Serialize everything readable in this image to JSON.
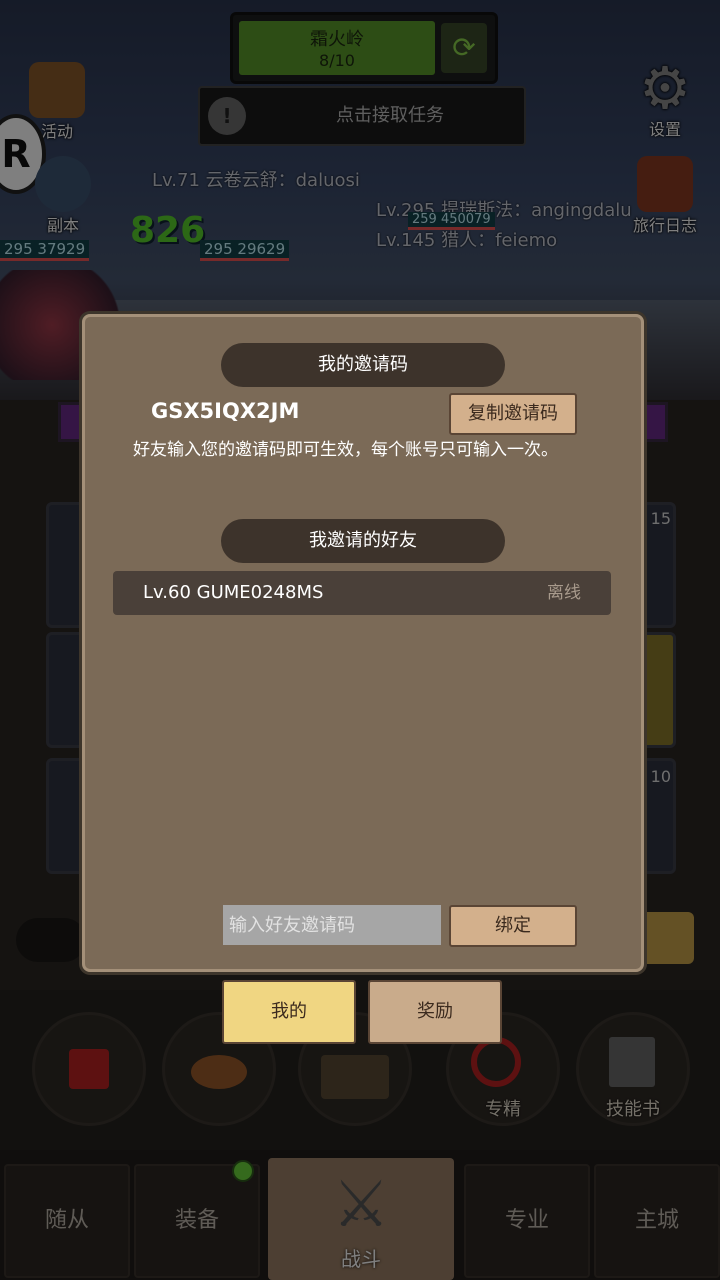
{
  "hud": {
    "stage_title": "霜火岭",
    "stage_progress": "8/10",
    "task_text": "点击接取任务",
    "activity_label": "活动",
    "dungeon_label": "副本",
    "settings_label": "设置",
    "travel_log_label": "旅行日志",
    "gold_amount": "826",
    "chat": [
      "Lv.71 云卷云舒：daluosi",
      "Lv.295 提瑞斯法：angingdalu",
      "Lv.145 猎人：feiemo"
    ],
    "hp_left": "37929",
    "hp_mid": "29629",
    "hp_right": "450079",
    "level_left": "295",
    "level_mid": "295",
    "level_right": "259"
  },
  "modal": {
    "invite_title": "我的邀请码",
    "invite_code": "GSX5IQX2JM",
    "copy_button": "复制邀请码",
    "description": "好友输入您的邀请码即可生效，每个账号只可输入一次。",
    "friends_title": "我邀请的好友",
    "friends": [
      {
        "name": "Lv.60 GUME0248MS",
        "status": "离线"
      }
    ],
    "input_placeholder": "输入好友邀请码",
    "bind_button": "绑定"
  },
  "tabs": {
    "mine": "我的",
    "reward": "奖励"
  },
  "lower": {
    "specialize": "专精",
    "skill_book": "技能书"
  },
  "side_numbers": {
    "top": "15",
    "bottom": "10"
  },
  "bottom_nav": {
    "followers": "随从",
    "equipment": "装备",
    "battle": "战斗",
    "profession": "专业",
    "main_city": "主城"
  },
  "colors": {
    "modal_bg": "#7b6a57",
    "banner_bg": "#3d332b",
    "active_tab": "#f0d682",
    "accent_green": "#59d12d"
  }
}
